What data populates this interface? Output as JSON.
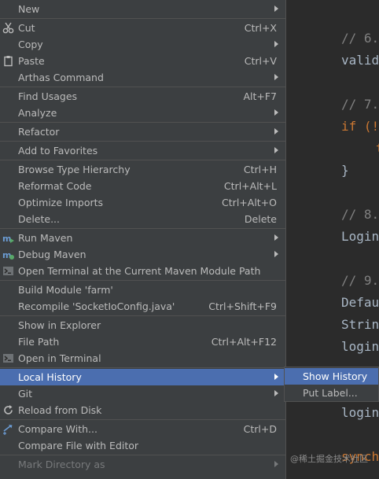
{
  "editor": {
    "lines": [
      {
        "text": "// 6.",
        "kind": "comment"
      },
      {
        "text": "valid",
        "kind": "code"
      },
      {
        "text": "// 7.",
        "kind": "comment"
      },
      {
        "text": "if (!",
        "kind": "keyword"
      },
      {
        "text": "t",
        "kind": "keyword"
      },
      {
        "text": "}",
        "kind": "code"
      },
      {
        "text": "// 8.",
        "kind": "comment"
      },
      {
        "text": "Login",
        "kind": "code"
      },
      {
        "text": "// 9.",
        "kind": "comment"
      },
      {
        "text": "Defau",
        "kind": "code"
      },
      {
        "text": "Strin",
        "kind": "code"
      },
      {
        "text": "login",
        "kind": "code"
      },
      {
        "text": "login",
        "kind": "code"
      },
      {
        "text": "synch",
        "kind": "keyword"
      }
    ],
    "watermark": "@稀土掘金技术社区"
  },
  "menu": {
    "items": [
      {
        "label": "New",
        "submenu": true
      },
      {
        "label": "Cut",
        "shortcut": "Ctrl+X",
        "icon": "cut-icon"
      },
      {
        "label": "Copy",
        "submenu": true
      },
      {
        "label": "Paste",
        "shortcut": "Ctrl+V",
        "icon": "paste-icon"
      },
      {
        "label": "Arthas Command",
        "submenu": true
      },
      {
        "label": "Find Usages",
        "shortcut": "Alt+F7"
      },
      {
        "label": "Analyze",
        "submenu": true
      },
      {
        "label": "Refactor",
        "submenu": true
      },
      {
        "label": "Add to Favorites",
        "submenu": true
      },
      {
        "label": "Browse Type Hierarchy",
        "shortcut": "Ctrl+H"
      },
      {
        "label": "Reformat Code",
        "shortcut": "Ctrl+Alt+L"
      },
      {
        "label": "Optimize Imports",
        "shortcut": "Ctrl+Alt+O"
      },
      {
        "label": "Delete...",
        "shortcut": "Delete"
      },
      {
        "label": "Run Maven",
        "submenu": true,
        "icon": "maven-run-icon"
      },
      {
        "label": "Debug Maven",
        "submenu": true,
        "icon": "maven-debug-icon"
      },
      {
        "label": "Open Terminal at the Current Maven Module Path",
        "icon": "terminal-icon"
      },
      {
        "label": "Build Module 'farm'"
      },
      {
        "label": "Recompile 'SocketIoConfig.java'",
        "shortcut": "Ctrl+Shift+F9"
      },
      {
        "label": "Show in Explorer"
      },
      {
        "label": "File Path",
        "shortcut": "Ctrl+Alt+F12"
      },
      {
        "label": "Open in Terminal",
        "icon": "terminal-icon"
      },
      {
        "label": "Local History",
        "submenu": true,
        "selected": true
      },
      {
        "label": "Git",
        "submenu": true
      },
      {
        "label": "Reload from Disk",
        "icon": "reload-icon"
      },
      {
        "label": "Compare With...",
        "shortcut": "Ctrl+D",
        "icon": "compare-icon"
      },
      {
        "label": "Compare File with Editor"
      },
      {
        "label": "Mark Directory as",
        "submenu": true,
        "disabled": true
      }
    ]
  },
  "submenu": {
    "items": [
      {
        "label": "Show History",
        "selected": true
      },
      {
        "label": "Put Label..."
      }
    ]
  }
}
